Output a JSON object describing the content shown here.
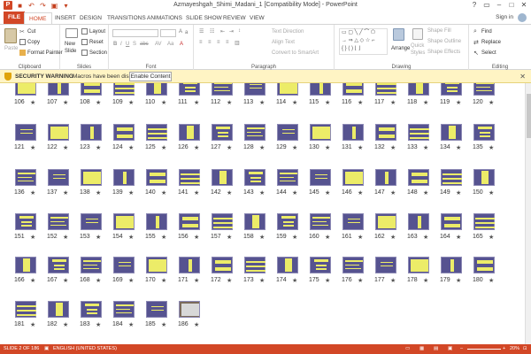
{
  "window": {
    "title": "Azmayeshgah_Shimi_Madani_1 [Compatibility Mode] - PowerPoint",
    "app_icon": "P",
    "sign_in": "Sign in"
  },
  "tabs": [
    "FILE",
    "HOME",
    "INSERT",
    "DESIGN",
    "TRANSITIONS",
    "ANIMATIONS",
    "SLIDE SHOW",
    "REVIEW",
    "VIEW"
  ],
  "ribbon": {
    "clipboard": {
      "paste": "Paste",
      "cut": "Cut",
      "copy": "Copy",
      "format_painter": "Format Painter",
      "label": "Clipboard"
    },
    "slides": {
      "new_slide": "New",
      "new_slide_2": "Slide",
      "layout": "Layout",
      "reset": "Reset",
      "section": "Section",
      "label": "Slides"
    },
    "font": {
      "label": "Font"
    },
    "paragraph": {
      "text_direction": "Text Direction",
      "align_text": "Align Text",
      "convert": "Convert to SmartArt",
      "label": "Paragraph"
    },
    "drawing": {
      "arrange": "Arrange",
      "quick_styles": "Quick",
      "quick_styles_2": "Styles",
      "shape_fill": "Shape Fill",
      "shape_outline": "Shape Outline",
      "shape_effects": "Shape Effects",
      "label": "Drawing"
    },
    "editing": {
      "find": "Find",
      "replace": "Replace",
      "select": "Select",
      "label": "Editing"
    }
  },
  "security_bar": {
    "title": "SECURITY WARNING",
    "message": "Macros have been disabled.",
    "button": "Enable Content"
  },
  "slides": [
    {
      "n": "106"
    },
    {
      "n": "107"
    },
    {
      "n": "108"
    },
    {
      "n": "109"
    },
    {
      "n": "110"
    },
    {
      "n": "111"
    },
    {
      "n": "112"
    },
    {
      "n": "113"
    },
    {
      "n": "114"
    },
    {
      "n": "115"
    },
    {
      "n": "116"
    },
    {
      "n": "117"
    },
    {
      "n": "118"
    },
    {
      "n": "119"
    },
    {
      "n": "120"
    },
    {
      "n": "121"
    },
    {
      "n": "122"
    },
    {
      "n": "123"
    },
    {
      "n": "124"
    },
    {
      "n": "125"
    },
    {
      "n": "126"
    },
    {
      "n": "127"
    },
    {
      "n": "128"
    },
    {
      "n": "129"
    },
    {
      "n": "130"
    },
    {
      "n": "131"
    },
    {
      "n": "132"
    },
    {
      "n": "133"
    },
    {
      "n": "134"
    },
    {
      "n": "135"
    },
    {
      "n": "136"
    },
    {
      "n": "137"
    },
    {
      "n": "138"
    },
    {
      "n": "139"
    },
    {
      "n": "140"
    },
    {
      "n": "141"
    },
    {
      "n": "142"
    },
    {
      "n": "143"
    },
    {
      "n": "144"
    },
    {
      "n": "145"
    },
    {
      "n": "146"
    },
    {
      "n": "147"
    },
    {
      "n": "148"
    },
    {
      "n": "149"
    },
    {
      "n": "150"
    },
    {
      "n": "151"
    },
    {
      "n": "152"
    },
    {
      "n": "153"
    },
    {
      "n": "154"
    },
    {
      "n": "155"
    },
    {
      "n": "156"
    },
    {
      "n": "157"
    },
    {
      "n": "158"
    },
    {
      "n": "159"
    },
    {
      "n": "160"
    },
    {
      "n": "161"
    },
    {
      "n": "162"
    },
    {
      "n": "163"
    },
    {
      "n": "164"
    },
    {
      "n": "165"
    },
    {
      "n": "166"
    },
    {
      "n": "167"
    },
    {
      "n": "168"
    },
    {
      "n": "169"
    },
    {
      "n": "170"
    },
    {
      "n": "171"
    },
    {
      "n": "172"
    },
    {
      "n": "173"
    },
    {
      "n": "174"
    },
    {
      "n": "175"
    },
    {
      "n": "176"
    },
    {
      "n": "177"
    },
    {
      "n": "178"
    },
    {
      "n": "179"
    },
    {
      "n": "180"
    },
    {
      "n": "181"
    },
    {
      "n": "182"
    },
    {
      "n": "183"
    },
    {
      "n": "184"
    },
    {
      "n": "185"
    },
    {
      "n": "186"
    }
  ],
  "status": {
    "slide_info": "SLIDE 2 OF 186",
    "language": "ENGLISH (UNITED STATES)",
    "zoom": "20%"
  },
  "colors": {
    "accent": "#d24726",
    "slide_bg": "#565390",
    "slide_text": "#ecec68",
    "warning_bg": "#fff4c4"
  }
}
